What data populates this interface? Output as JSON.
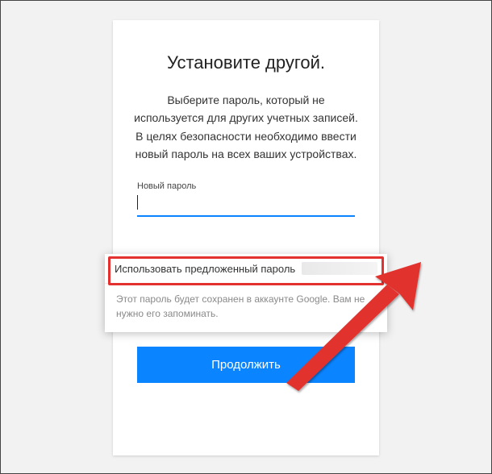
{
  "title": "Установите другой.",
  "description": "Выберите пароль, который не используется для других учетных записей. В целях безопасности необходимо ввести новый пароль на всех ваших устройствах.",
  "field": {
    "label": "Новый пароль",
    "value": ""
  },
  "suggestion": {
    "option_label": "Использовать предложенный пароль",
    "hint": "Этот пароль будет сохранен в аккаунте Google. Вам не нужно его запоминать."
  },
  "submit_label": "Продолжить"
}
